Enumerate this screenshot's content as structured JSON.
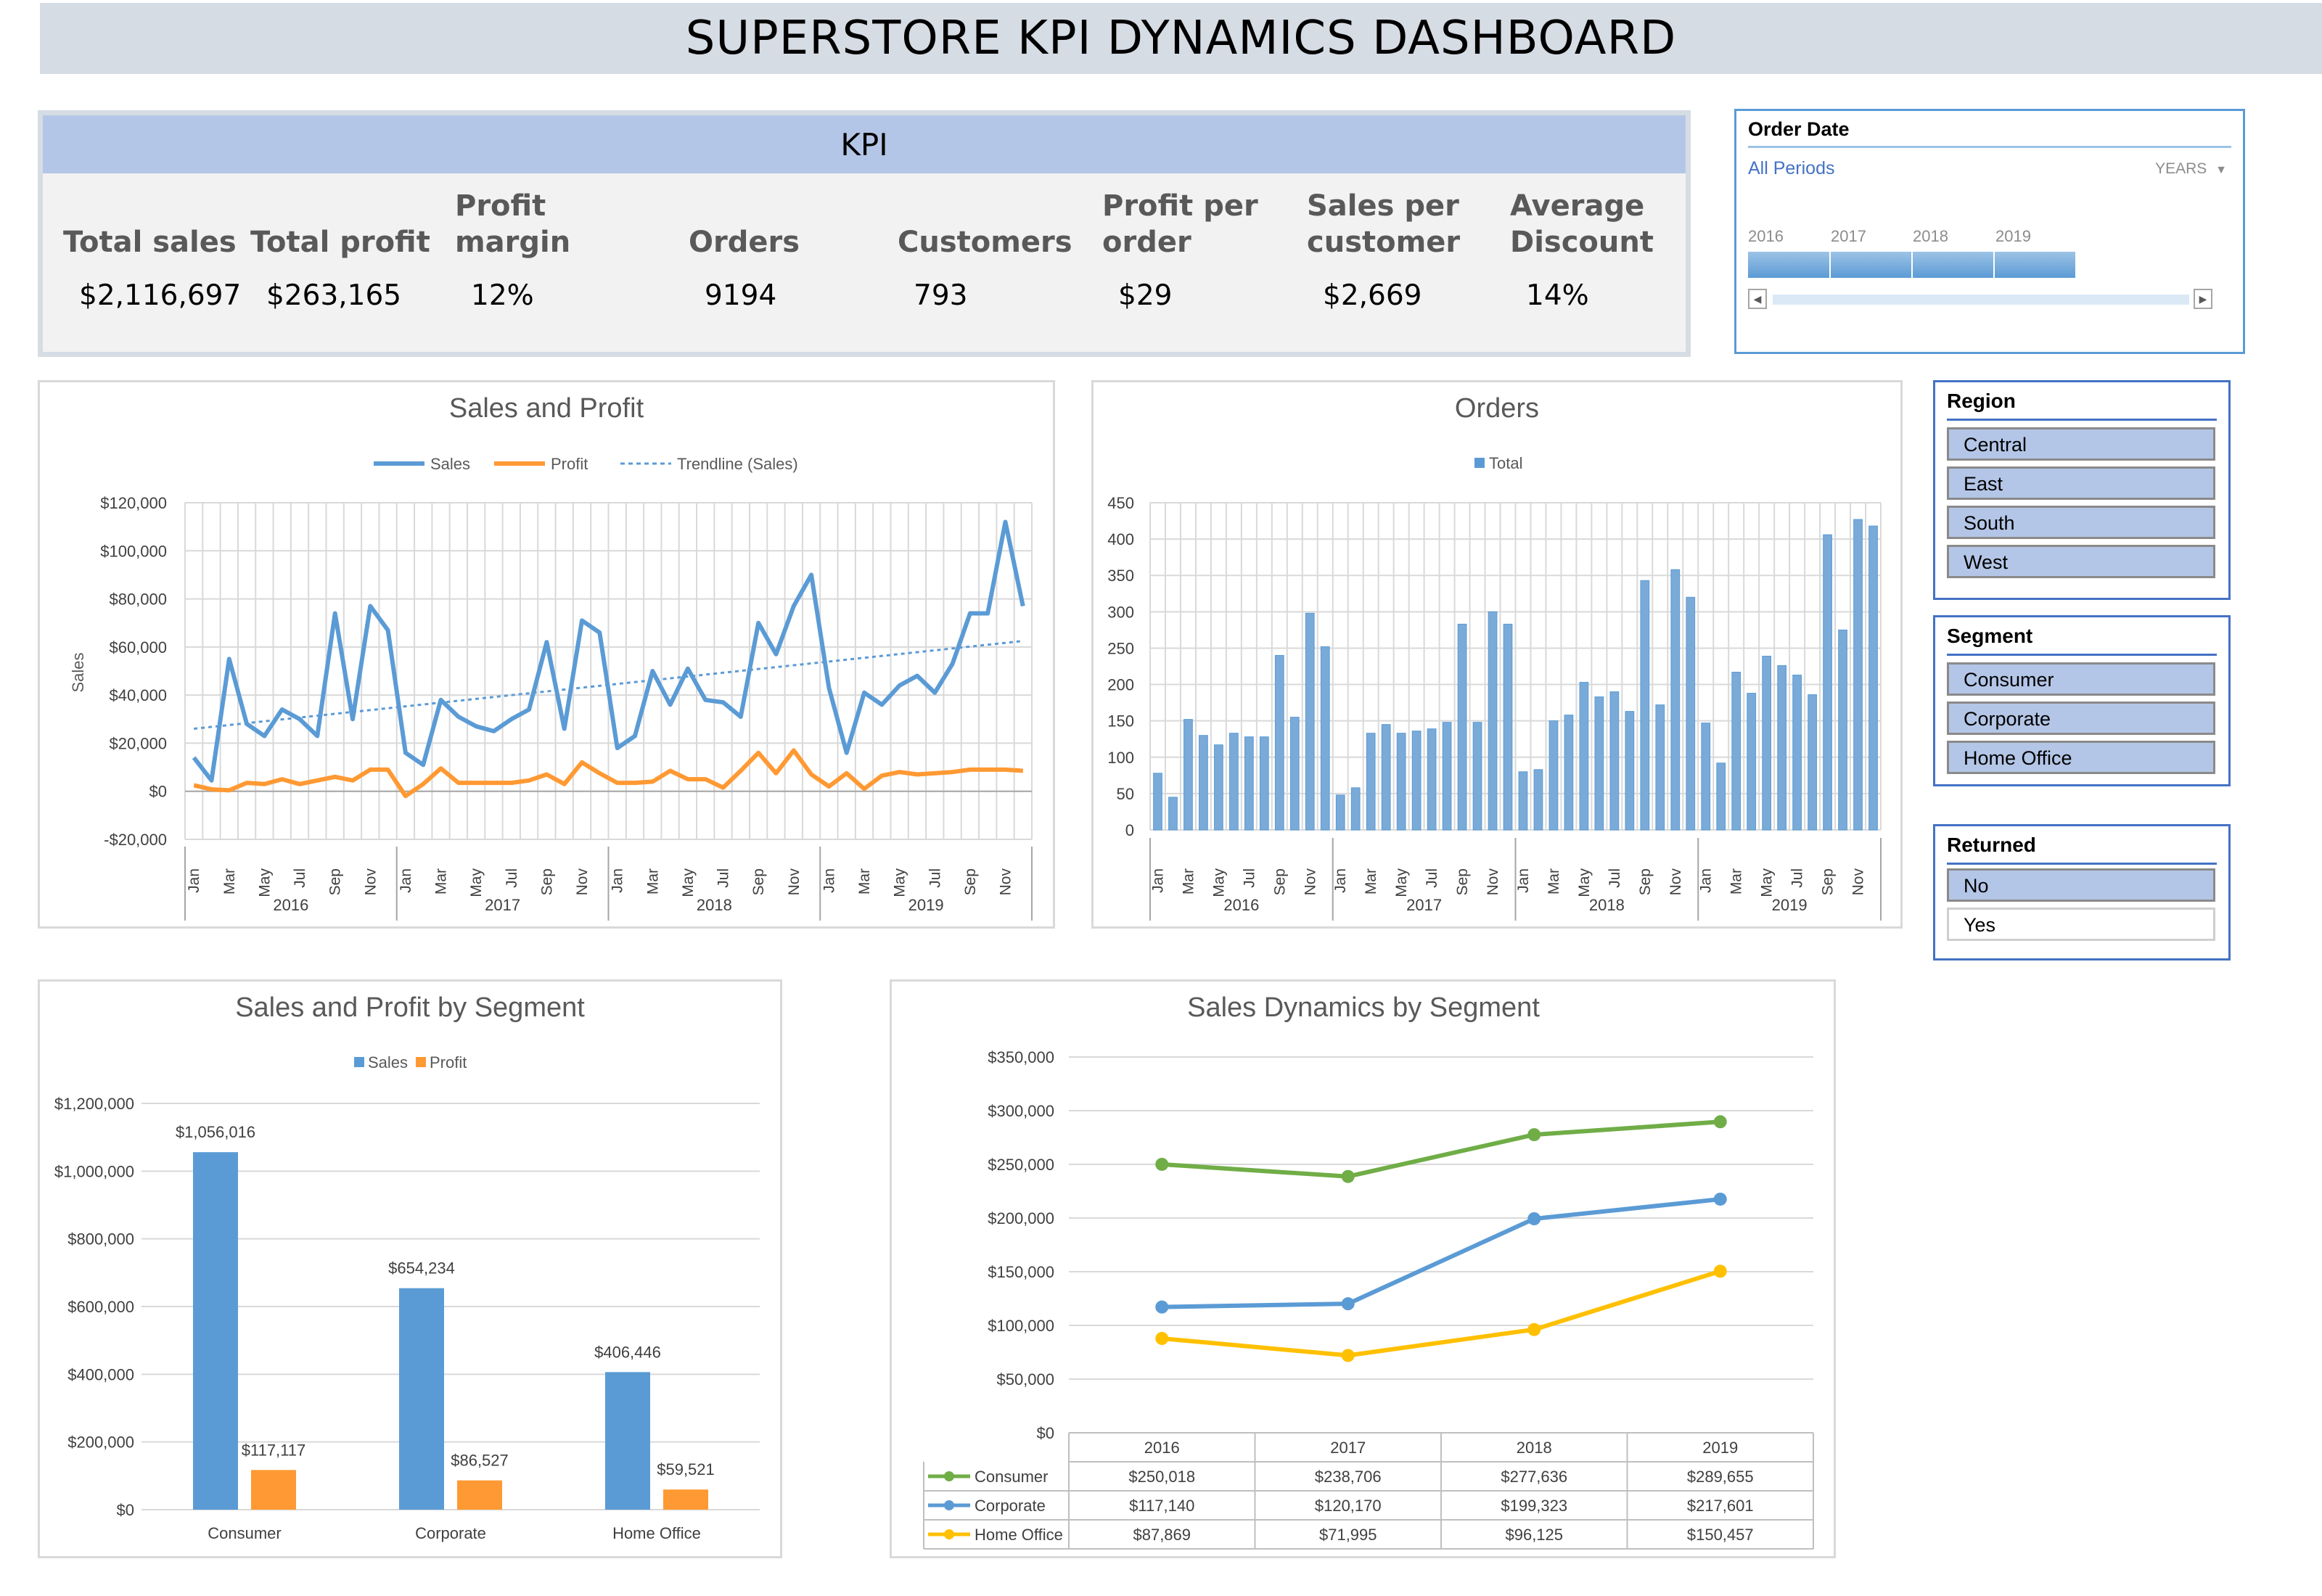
{
  "title": "SUPERSTORE KPI DYNAMICS DASHBOARD",
  "kpi": {
    "header": "KPI",
    "items": [
      {
        "label": "Total sales",
        "value": "$2,116,697"
      },
      {
        "label": "Total profit",
        "value": "$263,165"
      },
      {
        "label": "Profit margin",
        "value": "12%"
      },
      {
        "label": "Orders",
        "value": "9194"
      },
      {
        "label": "Customers",
        "value": "793"
      },
      {
        "label": "Profit per order",
        "value": "$29"
      },
      {
        "label": "Sales per customer",
        "value": "$2,669"
      },
      {
        "label": "Average Discount",
        "value": "14%"
      }
    ]
  },
  "timeline": {
    "title": "Order Date",
    "period": "All Periods",
    "unit": "YEARS",
    "years": [
      "2016",
      "2017",
      "2018",
      "2019"
    ]
  },
  "slicers": {
    "region": {
      "title": "Region",
      "items": [
        "Central",
        "East",
        "South",
        "West"
      ],
      "selected": [
        true,
        true,
        true,
        true
      ]
    },
    "segment": {
      "title": "Segment",
      "items": [
        "Consumer",
        "Corporate",
        "Home Office"
      ],
      "selected": [
        true,
        true,
        true
      ]
    },
    "returned": {
      "title": "Returned",
      "items": [
        "No",
        "Yes"
      ],
      "selected": [
        true,
        false
      ]
    }
  },
  "colors": {
    "blue": "#5b9bd5",
    "orange": "#ff9933",
    "green": "#70ad47",
    "gold": "#ffc000",
    "accent": "#4472c4"
  },
  "chart_data": [
    {
      "id": "sales-profit",
      "type": "line",
      "title": "Sales and Profit",
      "ylabel": "Sales",
      "ylim": [
        -20000,
        120000
      ],
      "yticks": [
        "-$20,000",
        "$0",
        "$20,000",
        "$40,000",
        "$60,000",
        "$80,000",
        "$100,000",
        "$120,000"
      ],
      "months": [
        "Jan",
        "",
        "Mar",
        "",
        "May",
        "",
        "Jul",
        "",
        "Sep",
        "",
        "Nov",
        ""
      ],
      "years": [
        "2016",
        "2017",
        "2018",
        "2019"
      ],
      "legend": [
        "Sales",
        "Profit",
        "Trendline (Sales)"
      ],
      "series": [
        {
          "name": "Sales",
          "values": [
            14000,
            4500,
            55000,
            28000,
            23000,
            34000,
            30000,
            23000,
            74000,
            30000,
            77000,
            67000,
            16000,
            11000,
            38000,
            31000,
            27000,
            25000,
            30000,
            34000,
            62000,
            26000,
            71000,
            66000,
            18000,
            23000,
            50000,
            36000,
            51000,
            38000,
            37000,
            31000,
            70000,
            57000,
            77000,
            90000,
            43000,
            16000,
            41000,
            36000,
            44000,
            48000,
            41000,
            53000,
            74000,
            74000,
            112000,
            77000
          ]
        },
        {
          "name": "Profit",
          "values": [
            2500,
            800,
            400,
            3500,
            3000,
            5000,
            3000,
            4500,
            6000,
            4500,
            9000,
            9000,
            -2000,
            3000,
            9500,
            3500,
            3500,
            3500,
            3500,
            4500,
            7000,
            3000,
            12000,
            7500,
            3500,
            3500,
            4000,
            8500,
            5000,
            5000,
            1500,
            8500,
            16000,
            7500,
            17000,
            7000,
            2000,
            7500,
            1000,
            6500,
            8000,
            7000,
            7500,
            8000,
            9000,
            9000,
            9000,
            8500
          ]
        },
        {
          "name": "Trendline (Sales)",
          "values": [
            26000,
            62500
          ]
        }
      ]
    },
    {
      "id": "orders",
      "type": "bar",
      "title": "Orders",
      "ylim": [
        0,
        450
      ],
      "yticks": [
        "0",
        "50",
        "100",
        "150",
        "200",
        "250",
        "300",
        "350",
        "400",
        "450"
      ],
      "months": [
        "Jan",
        "",
        "Mar",
        "",
        "May",
        "",
        "Jul",
        "",
        "Sep",
        "",
        "Nov",
        ""
      ],
      "years": [
        "2016",
        "2017",
        "2018",
        "2019"
      ],
      "legend": [
        "Total"
      ],
      "series": [
        {
          "name": "Total",
          "values": [
            78,
            45,
            152,
            130,
            117,
            133,
            128,
            128,
            240,
            155,
            298,
            252,
            48,
            58,
            133,
            145,
            133,
            136,
            139,
            148,
            283,
            148,
            300,
            283,
            80,
            83,
            150,
            158,
            203,
            183,
            190,
            163,
            343,
            172,
            358,
            320,
            147,
            92,
            217,
            188,
            239,
            226,
            213,
            186,
            406,
            275,
            427,
            418
          ]
        }
      ]
    },
    {
      "id": "segment-sp",
      "type": "bar",
      "title": "Sales and Profit by Segment",
      "categories": [
        "Consumer",
        "Corporate",
        "Home Office"
      ],
      "ylim": [
        0,
        1200000
      ],
      "yticks": [
        "$0",
        "$200,000",
        "$400,000",
        "$600,000",
        "$800,000",
        "$1,000,000",
        "$1,200,000"
      ],
      "legend": [
        "Sales",
        "Profit"
      ],
      "series": [
        {
          "name": "Sales",
          "values": [
            1056016,
            654234,
            406446
          ],
          "labels": [
            "$1,056,016",
            "$654,234",
            "$406,446"
          ]
        },
        {
          "name": "Profit",
          "values": [
            117117,
            86527,
            59521
          ],
          "labels": [
            "$117,117",
            "$86,527",
            "$59,521"
          ]
        }
      ]
    },
    {
      "id": "segment-dyn",
      "type": "line",
      "title": "Sales Dynamics by Segment",
      "categories": [
        "2016",
        "2017",
        "2018",
        "2019"
      ],
      "ylim": [
        0,
        350000
      ],
      "yticks": [
        "$0",
        "$50,000",
        "$100,000",
        "$150,000",
        "$200,000",
        "$250,000",
        "$300,000",
        "$350,000"
      ],
      "series": [
        {
          "name": "Consumer",
          "values": [
            250018,
            238706,
            277636,
            289655
          ],
          "labels": [
            "$250,018",
            "$238,706",
            "$277,636",
            "$289,655"
          ]
        },
        {
          "name": "Corporate",
          "values": [
            117140,
            120170,
            199323,
            217601
          ],
          "labels": [
            "$117,140",
            "$120,170",
            "$199,323",
            "$217,601"
          ]
        },
        {
          "name": "Home Office",
          "values": [
            87869,
            71995,
            96125,
            150457
          ],
          "labels": [
            "$87,869",
            "$71,995",
            "$96,125",
            "$150,457"
          ]
        }
      ]
    }
  ]
}
